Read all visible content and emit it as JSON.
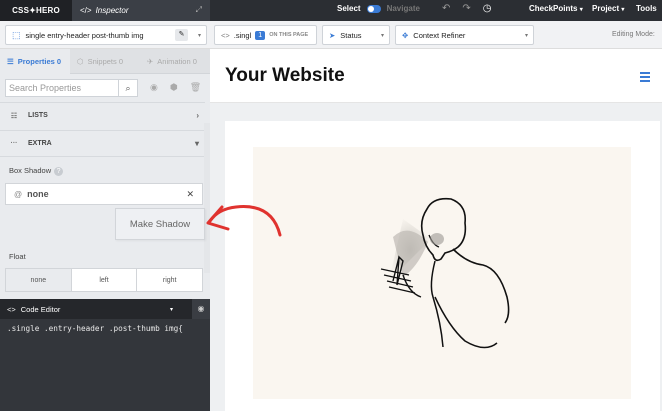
{
  "topbar": {
    "logo": "CSS✦HERO",
    "inspector_tab": "Inspector",
    "select_label": "Select",
    "navigate_label": "Navigate",
    "menus": [
      "CheckPoints",
      "Project",
      "Tools"
    ]
  },
  "selbar": {
    "selector": "single entry-header post-thumb img",
    "class_box": ".singl",
    "count": "1",
    "on_this_page": "ON THIS PAGE",
    "status": "Status",
    "context_refiner": "Context Refiner",
    "editing_mode": "Editing Mode:"
  },
  "panel": {
    "tabs": [
      "Properties 0",
      "Snippets 0",
      "Animation 0"
    ],
    "search_placeholder": "Search Properties",
    "sections": [
      "LISTS",
      "EXTRA"
    ],
    "box_shadow_label": "Box Shadow",
    "box_shadow_value": "none",
    "make_shadow": "Make Shadow",
    "float_label": "Float",
    "float_options": [
      "none",
      "left",
      "right"
    ]
  },
  "code_editor": {
    "title": "Code Editor",
    "code": ".single .entry-header .post-thumb img{"
  },
  "preview": {
    "site_title": "Your Website"
  },
  "colors": {
    "accent": "#3a7bd5",
    "arrow": "#e0332f",
    "dark": "#2b2e33"
  }
}
